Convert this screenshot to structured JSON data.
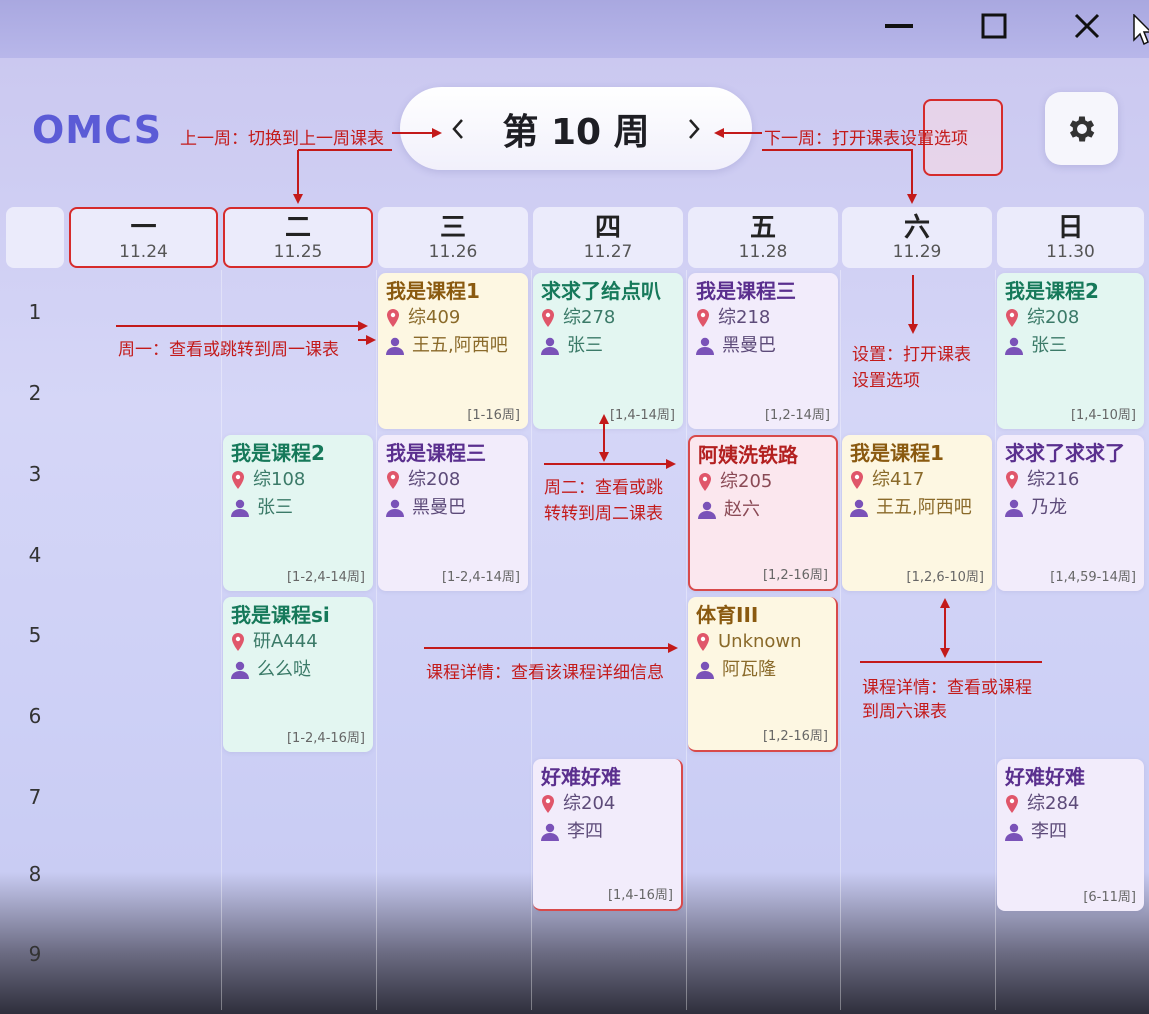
{
  "app": {
    "logo": "OMCS"
  },
  "header": {
    "week_title": "第 10 周"
  },
  "days": [
    {
      "name": "一",
      "date": "11.24"
    },
    {
      "name": "二",
      "date": "11.25"
    },
    {
      "name": "三",
      "date": "11.26"
    },
    {
      "name": "四",
      "date": "11.27"
    },
    {
      "name": "五",
      "date": "11.28"
    },
    {
      "name": "六",
      "date": "11.29"
    },
    {
      "name": "日",
      "date": "11.30"
    }
  ],
  "slots": [
    "1",
    "2",
    "3",
    "4",
    "5",
    "6",
    "7",
    "8",
    "9"
  ],
  "courses": [
    {
      "name": "我是课程1",
      "room": "综409",
      "teacher": "王五,阿西吧",
      "weeks": "[1-16周]"
    },
    {
      "name": "求求了给点叭",
      "room": "综278",
      "teacher": "张三",
      "weeks": "[1,4-14周]"
    },
    {
      "name": "我是课程三",
      "room": "综218",
      "teacher": "黑曼巴",
      "weeks": "[1,2-14周]"
    },
    {
      "name": "我是课程2",
      "room": "综208",
      "teacher": "张三",
      "weeks": "[1,4-10周]"
    },
    {
      "name": "我是课程2",
      "room": "综108",
      "teacher": "张三",
      "weeks": "[1-2,4-14周]"
    },
    {
      "name": "我是课程三",
      "room": "综208",
      "teacher": "黑曼巴",
      "weeks": "[1-2,4-14周]"
    },
    {
      "name": "阿姨洗铁路",
      "room": "综205",
      "teacher": "赵六",
      "weeks": "[1,2-16周]"
    },
    {
      "name": "我是课程1",
      "room": "综417",
      "teacher": "王五,阿西吧",
      "weeks": "[1,2,6-10周]"
    },
    {
      "name": "求求了求求了",
      "room": "综216",
      "teacher": "乃龙",
      "weeks": "[1,4,59-14周]"
    },
    {
      "name": "我是课程si",
      "room": "研A444",
      "teacher": "么么哒",
      "weeks": "[1-2,4-16周]"
    },
    {
      "name": "体育III",
      "room": "Unknown",
      "teacher": "阿瓦隆",
      "weeks": "[1,2-16周]"
    },
    {
      "name": "好难好难",
      "room": "综204",
      "teacher": "李四",
      "weeks": "[1,4-16周]"
    },
    {
      "name": "好难好难",
      "room": "综284",
      "teacher": "李四",
      "weeks": "[6-11周]"
    }
  ],
  "annotations": {
    "prev_week": "上一周：切换到上一周课表",
    "next_week": "下一周：打开课表设置选项",
    "monday": "周一：查看或跳转到周一课表",
    "settings_1": "设置：打开课表",
    "settings_2": "设置选项",
    "tuesday_1": "周二：查看或跳",
    "tuesday_2": "转转到周二课表",
    "detail_1": "课程详情：查看该课程详细信息",
    "detail_2a": "课程详情：查看或课程",
    "detail_2b": "到周六课表"
  },
  "colors": {
    "logo": "#5b5bd6",
    "annotation": "#c31a1a",
    "accent": "#d62b2b"
  },
  "icons": {
    "location": "location-pin-icon",
    "teacher": "person-icon",
    "settings": "gear-icon"
  }
}
